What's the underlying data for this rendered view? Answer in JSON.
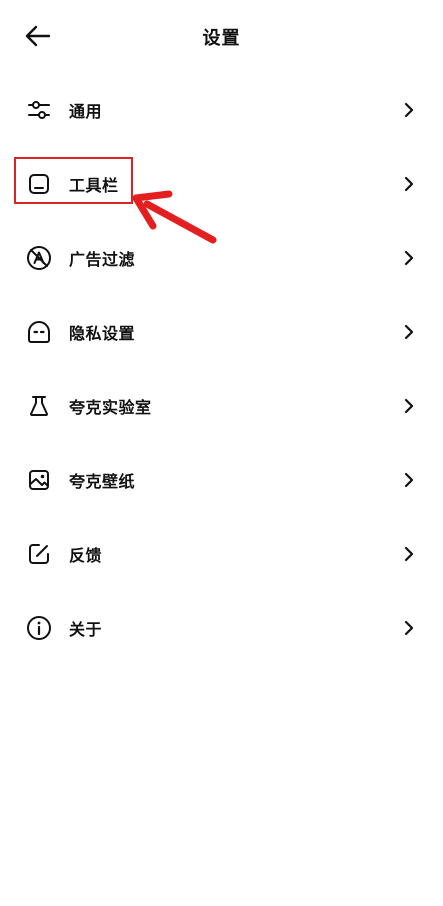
{
  "header": {
    "title": "设置",
    "back_icon": "arrow-left-icon"
  },
  "menu": {
    "items": [
      {
        "label": "通用",
        "icon": "sliders-icon"
      },
      {
        "label": "工具栏",
        "icon": "toolbar-icon"
      },
      {
        "label": "广告过滤",
        "icon": "ad-block-icon"
      },
      {
        "label": "隐私设置",
        "icon": "privacy-icon"
      },
      {
        "label": "夸克实验室",
        "icon": "flask-icon"
      },
      {
        "label": "夸克壁纸",
        "icon": "image-icon"
      },
      {
        "label": "反馈",
        "icon": "edit-icon"
      },
      {
        "label": "关于",
        "icon": "info-icon"
      }
    ]
  },
  "annotation": {
    "highlighted_item": "工具栏",
    "color": "#d92525"
  }
}
